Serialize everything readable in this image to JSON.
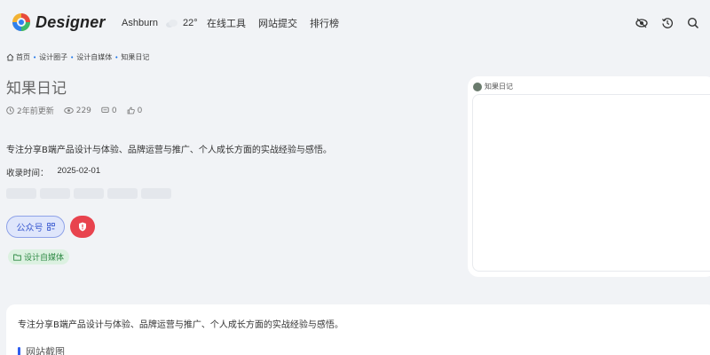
{
  "brand": {
    "name": "Designer"
  },
  "weather": {
    "city": "Ashburn",
    "temp": "22°"
  },
  "nav": {
    "items": [
      "在线工具",
      "网站提交",
      "排行榜"
    ]
  },
  "breadcrumb": {
    "items": [
      "首页",
      "设计圈子",
      "设计自媒体",
      "知果日记"
    ]
  },
  "site": {
    "title": "知果日记",
    "updated": "2年前更新",
    "views": "229",
    "comments": "0",
    "likes": "0",
    "description": "专注分享B端产品设计与体验、品牌运营与推广、个人成长方面的实战经验与感悟。",
    "collected_label": "收录时间：",
    "collected_date": "2025-02-01",
    "wechat_label": "公众号",
    "tag": "设计自媒体"
  },
  "preview": {
    "label": "知果日记"
  },
  "content": {
    "description": "专注分享B端产品设计与体验、品牌运营与推广、个人成长方面的实战经验与感悟。",
    "section_title": "网站截图"
  },
  "colors": {
    "accent": "#2f5ef0",
    "danger": "#e8434e",
    "tag_bg": "#dcf1e1",
    "tag_fg": "#2f8a45"
  }
}
